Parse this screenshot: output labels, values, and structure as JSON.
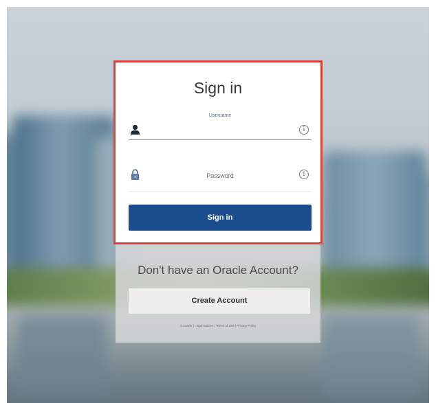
{
  "card": {
    "title": "Sign in",
    "accent_border": "#d9433a"
  },
  "username": {
    "floating_label": "Username",
    "value": "",
    "icon": "user-icon",
    "info_icon": "info-icon"
  },
  "password": {
    "placeholder": "Password",
    "value": "",
    "icon": "lock-icon",
    "info_icon": "info-icon"
  },
  "signin_button": {
    "label": "Sign in",
    "color": "#1b4d8e"
  },
  "lower_panel": {
    "prompt": "Don't have an Oracle Account?",
    "create_button_label": "Create Account"
  },
  "footer": {
    "links": [
      "© Oracle",
      "Legal Notices",
      "Terms of Use",
      "Privacy Policy"
    ],
    "separator": " | "
  }
}
